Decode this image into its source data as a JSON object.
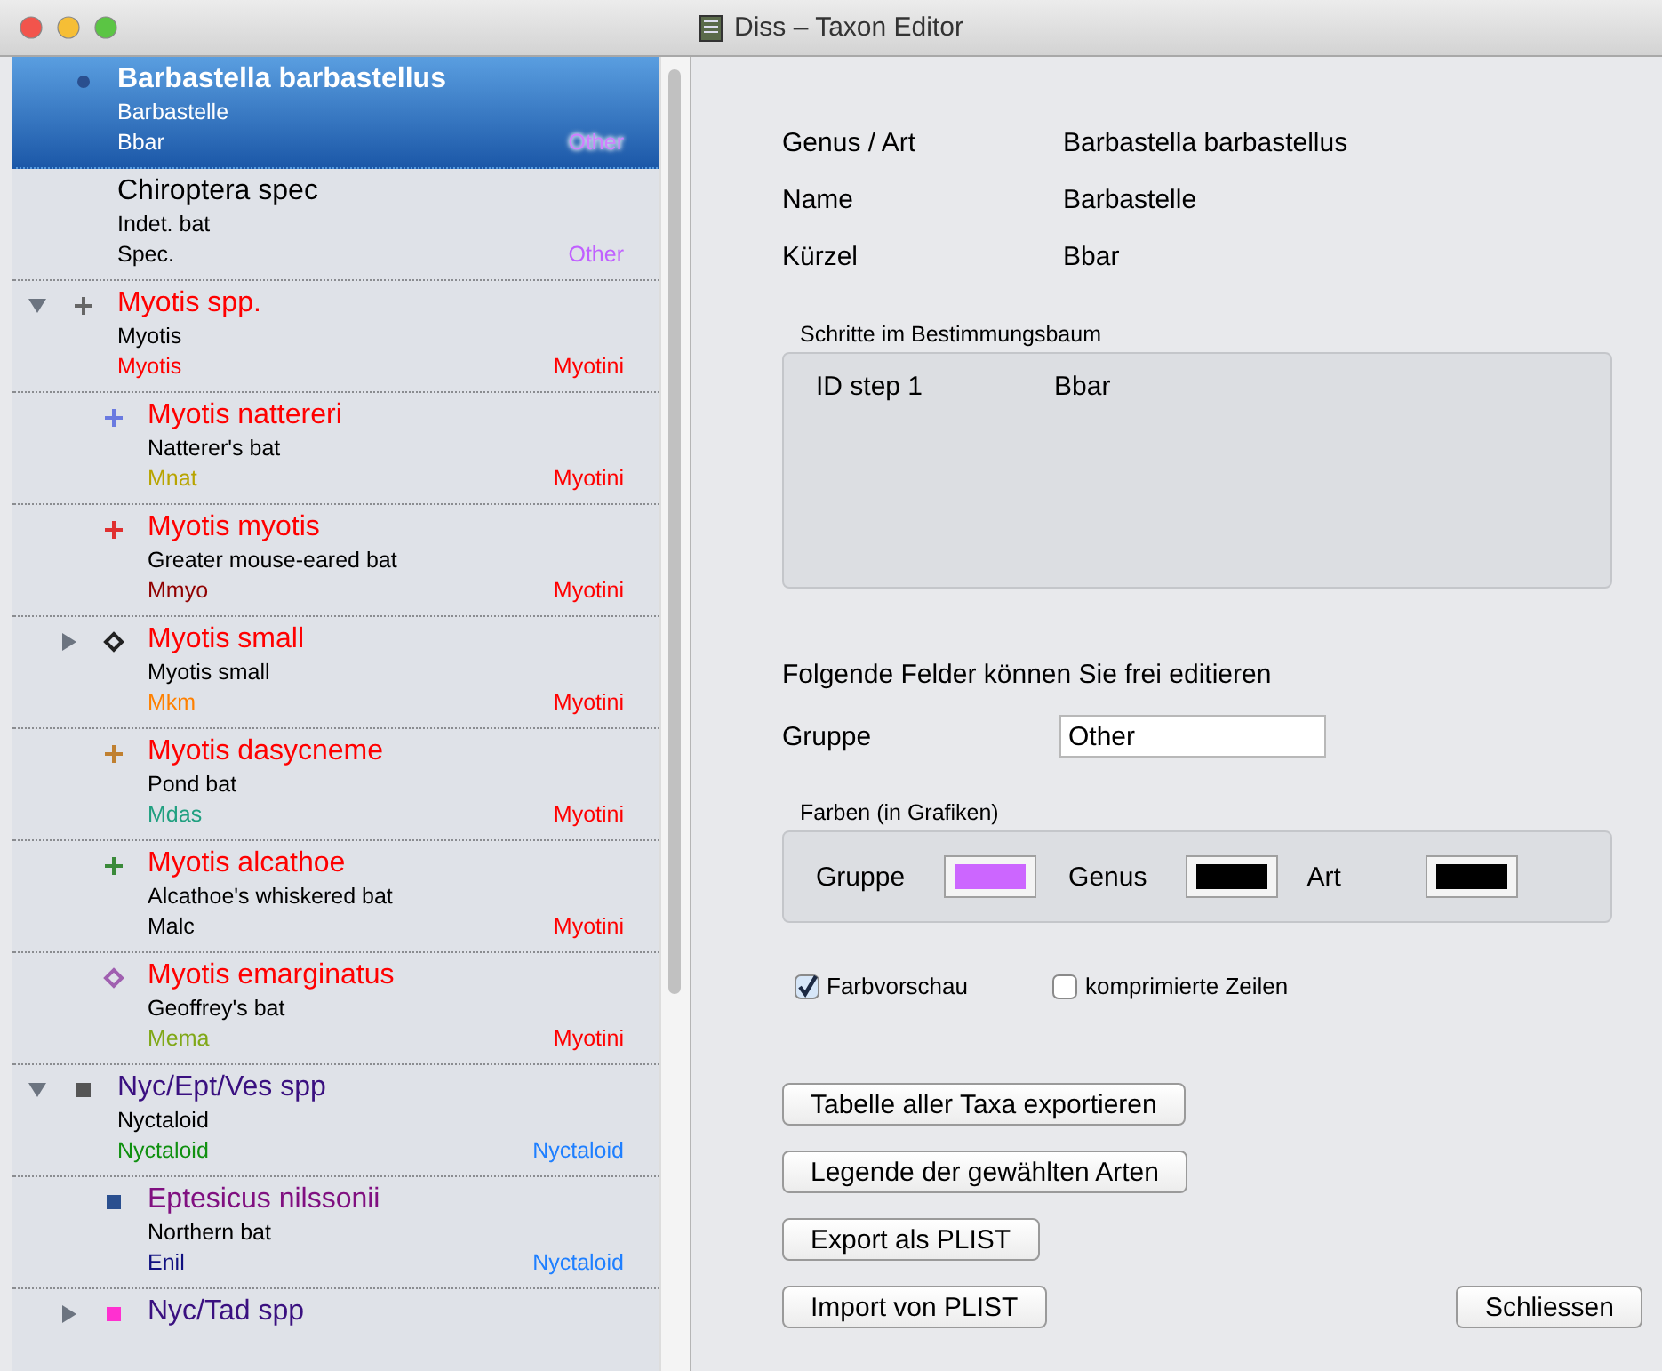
{
  "window": {
    "title": "Diss – Taxon Editor"
  },
  "taxa": [
    {
      "title": {
        "text": "Barbastella barbastellus",
        "color": "#ffffff"
      },
      "common": "Barbastelle",
      "code": {
        "text": "Bbar",
        "color": "#ffffff"
      },
      "group": {
        "text": "Other",
        "color": "#d080ff"
      },
      "marker": {
        "kind": "dot",
        "color": "#2a4f8f"
      },
      "selected": true
    },
    {
      "title": {
        "text": "Chiroptera spec",
        "color": "#000000"
      },
      "common": "Indet. bat",
      "code": {
        "text": "Spec.",
        "color": "#000000"
      },
      "group": {
        "text": "Other",
        "color": "#c060ff"
      },
      "selected": false
    },
    {
      "title": {
        "text": "Myotis spp.",
        "color": "#ff0000"
      },
      "common": "Myotis",
      "code": {
        "text": "Myotis",
        "color": "#ff0000"
      },
      "group": {
        "text": "Myotini",
        "color": "#ff0000"
      },
      "marker": {
        "kind": "plus",
        "color": "#666666"
      },
      "selected": false,
      "expanded": true,
      "children": [
        {
          "title": {
            "text": "Myotis nattereri",
            "color": "#ff0000"
          },
          "common": "Natterer's bat",
          "code": {
            "text": "Mnat",
            "color": "#b8a400"
          },
          "group": {
            "text": "Myotini",
            "color": "#ff0000"
          },
          "marker": {
            "kind": "plus",
            "color": "#6a7ae0"
          },
          "selected": false
        },
        {
          "title": {
            "text": "Myotis myotis",
            "color": "#ff0000"
          },
          "common": "Greater mouse-eared bat",
          "code": {
            "text": "Mmyo",
            "color": "#900000"
          },
          "group": {
            "text": "Myotini",
            "color": "#ff0000"
          },
          "marker": {
            "kind": "plus",
            "color": "#e03030"
          },
          "selected": false
        },
        {
          "title": {
            "text": "Myotis small",
            "color": "#ff0000"
          },
          "common": "Myotis small",
          "code": {
            "text": "Mkm",
            "color": "#ff8000"
          },
          "group": {
            "text": "Myotini",
            "color": "#ff0000"
          },
          "marker": {
            "kind": "diamond",
            "color": "#222222"
          },
          "selected": false,
          "expanded": false
        },
        {
          "title": {
            "text": "Myotis dasycneme",
            "color": "#ff0000"
          },
          "common": "Pond bat",
          "code": {
            "text": "Mdas",
            "color": "#20a080"
          },
          "group": {
            "text": "Myotini",
            "color": "#ff0000"
          },
          "marker": {
            "kind": "plus",
            "color": "#c08030"
          },
          "selected": false
        },
        {
          "title": {
            "text": "Myotis alcathoe",
            "color": "#ff0000"
          },
          "common": "Alcathoe's whiskered bat",
          "code": {
            "text": "Malc",
            "color": "#000000"
          },
          "group": {
            "text": "Myotini",
            "color": "#ff0000"
          },
          "marker": {
            "kind": "plus",
            "color": "#3a8a3a"
          },
          "selected": false
        },
        {
          "title": {
            "text": "Myotis emarginatus",
            "color": "#ff0000"
          },
          "common": "Geoffrey's bat",
          "code": {
            "text": "Mema",
            "color": "#80a818"
          },
          "group": {
            "text": "Myotini",
            "color": "#ff0000"
          },
          "marker": {
            "kind": "diamond",
            "color": "#a060b0"
          },
          "selected": false
        }
      ]
    },
    {
      "title": {
        "text": "Nyc/Ept/Ves spp",
        "color": "#3a1080"
      },
      "common": "Nyctaloid",
      "code": {
        "text": "Nyctaloid",
        "color": "#109010"
      },
      "group": {
        "text": "Nyctaloid",
        "color": "#1e7fff"
      },
      "marker": {
        "kind": "square",
        "color": "#555555"
      },
      "selected": false,
      "expanded": true,
      "children": [
        {
          "title": {
            "text": "Eptesicus nilssonii",
            "color": "#801080"
          },
          "common": "Northern bat",
          "code": {
            "text": "Enil",
            "color": "#101080"
          },
          "group": {
            "text": "Nyctaloid",
            "color": "#1e7fff"
          },
          "marker": {
            "kind": "square",
            "color": "#2a4f8f"
          },
          "selected": false
        },
        {
          "title": {
            "text": "Nyc/Tad spp",
            "color": "#3a1080"
          },
          "marker": {
            "kind": "square",
            "color": "#ff30d0"
          },
          "selected": false,
          "expanded": false
        }
      ]
    }
  ],
  "details": [
    {
      "label": "Genus / Art",
      "value": "Barbastella barbastellus"
    },
    {
      "label": "Name",
      "value": "Barbastelle"
    },
    {
      "label": "Kürzel",
      "value": "Bbar"
    }
  ],
  "steps_box": {
    "title": "Schritte im Bestimmungsbaum",
    "steps": [
      {
        "label": "ID step 1",
        "value": "Bbar"
      }
    ]
  },
  "editable_hint": "Folgende Felder können Sie frei editieren",
  "group_field": {
    "label": "Gruppe",
    "value": "Other"
  },
  "colors_box": {
    "title": "Farben (in Grafiken)",
    "swatches": [
      {
        "label": "Gruppe",
        "color": "#cc66ff"
      },
      {
        "label": "Genus",
        "color": "#000000"
      },
      {
        "label": "Art",
        "color": "#000000"
      }
    ]
  },
  "checkboxes": [
    {
      "label": "Farbvorschau",
      "checked": true
    },
    {
      "label": "komprimierte Zeilen",
      "checked": false
    }
  ],
  "buttons": [
    "Tabelle aller Taxa exportieren",
    "Legende der gewählten Arten",
    "Export als PLIST",
    "Import von PLIST"
  ],
  "close_button": "Schliessen"
}
